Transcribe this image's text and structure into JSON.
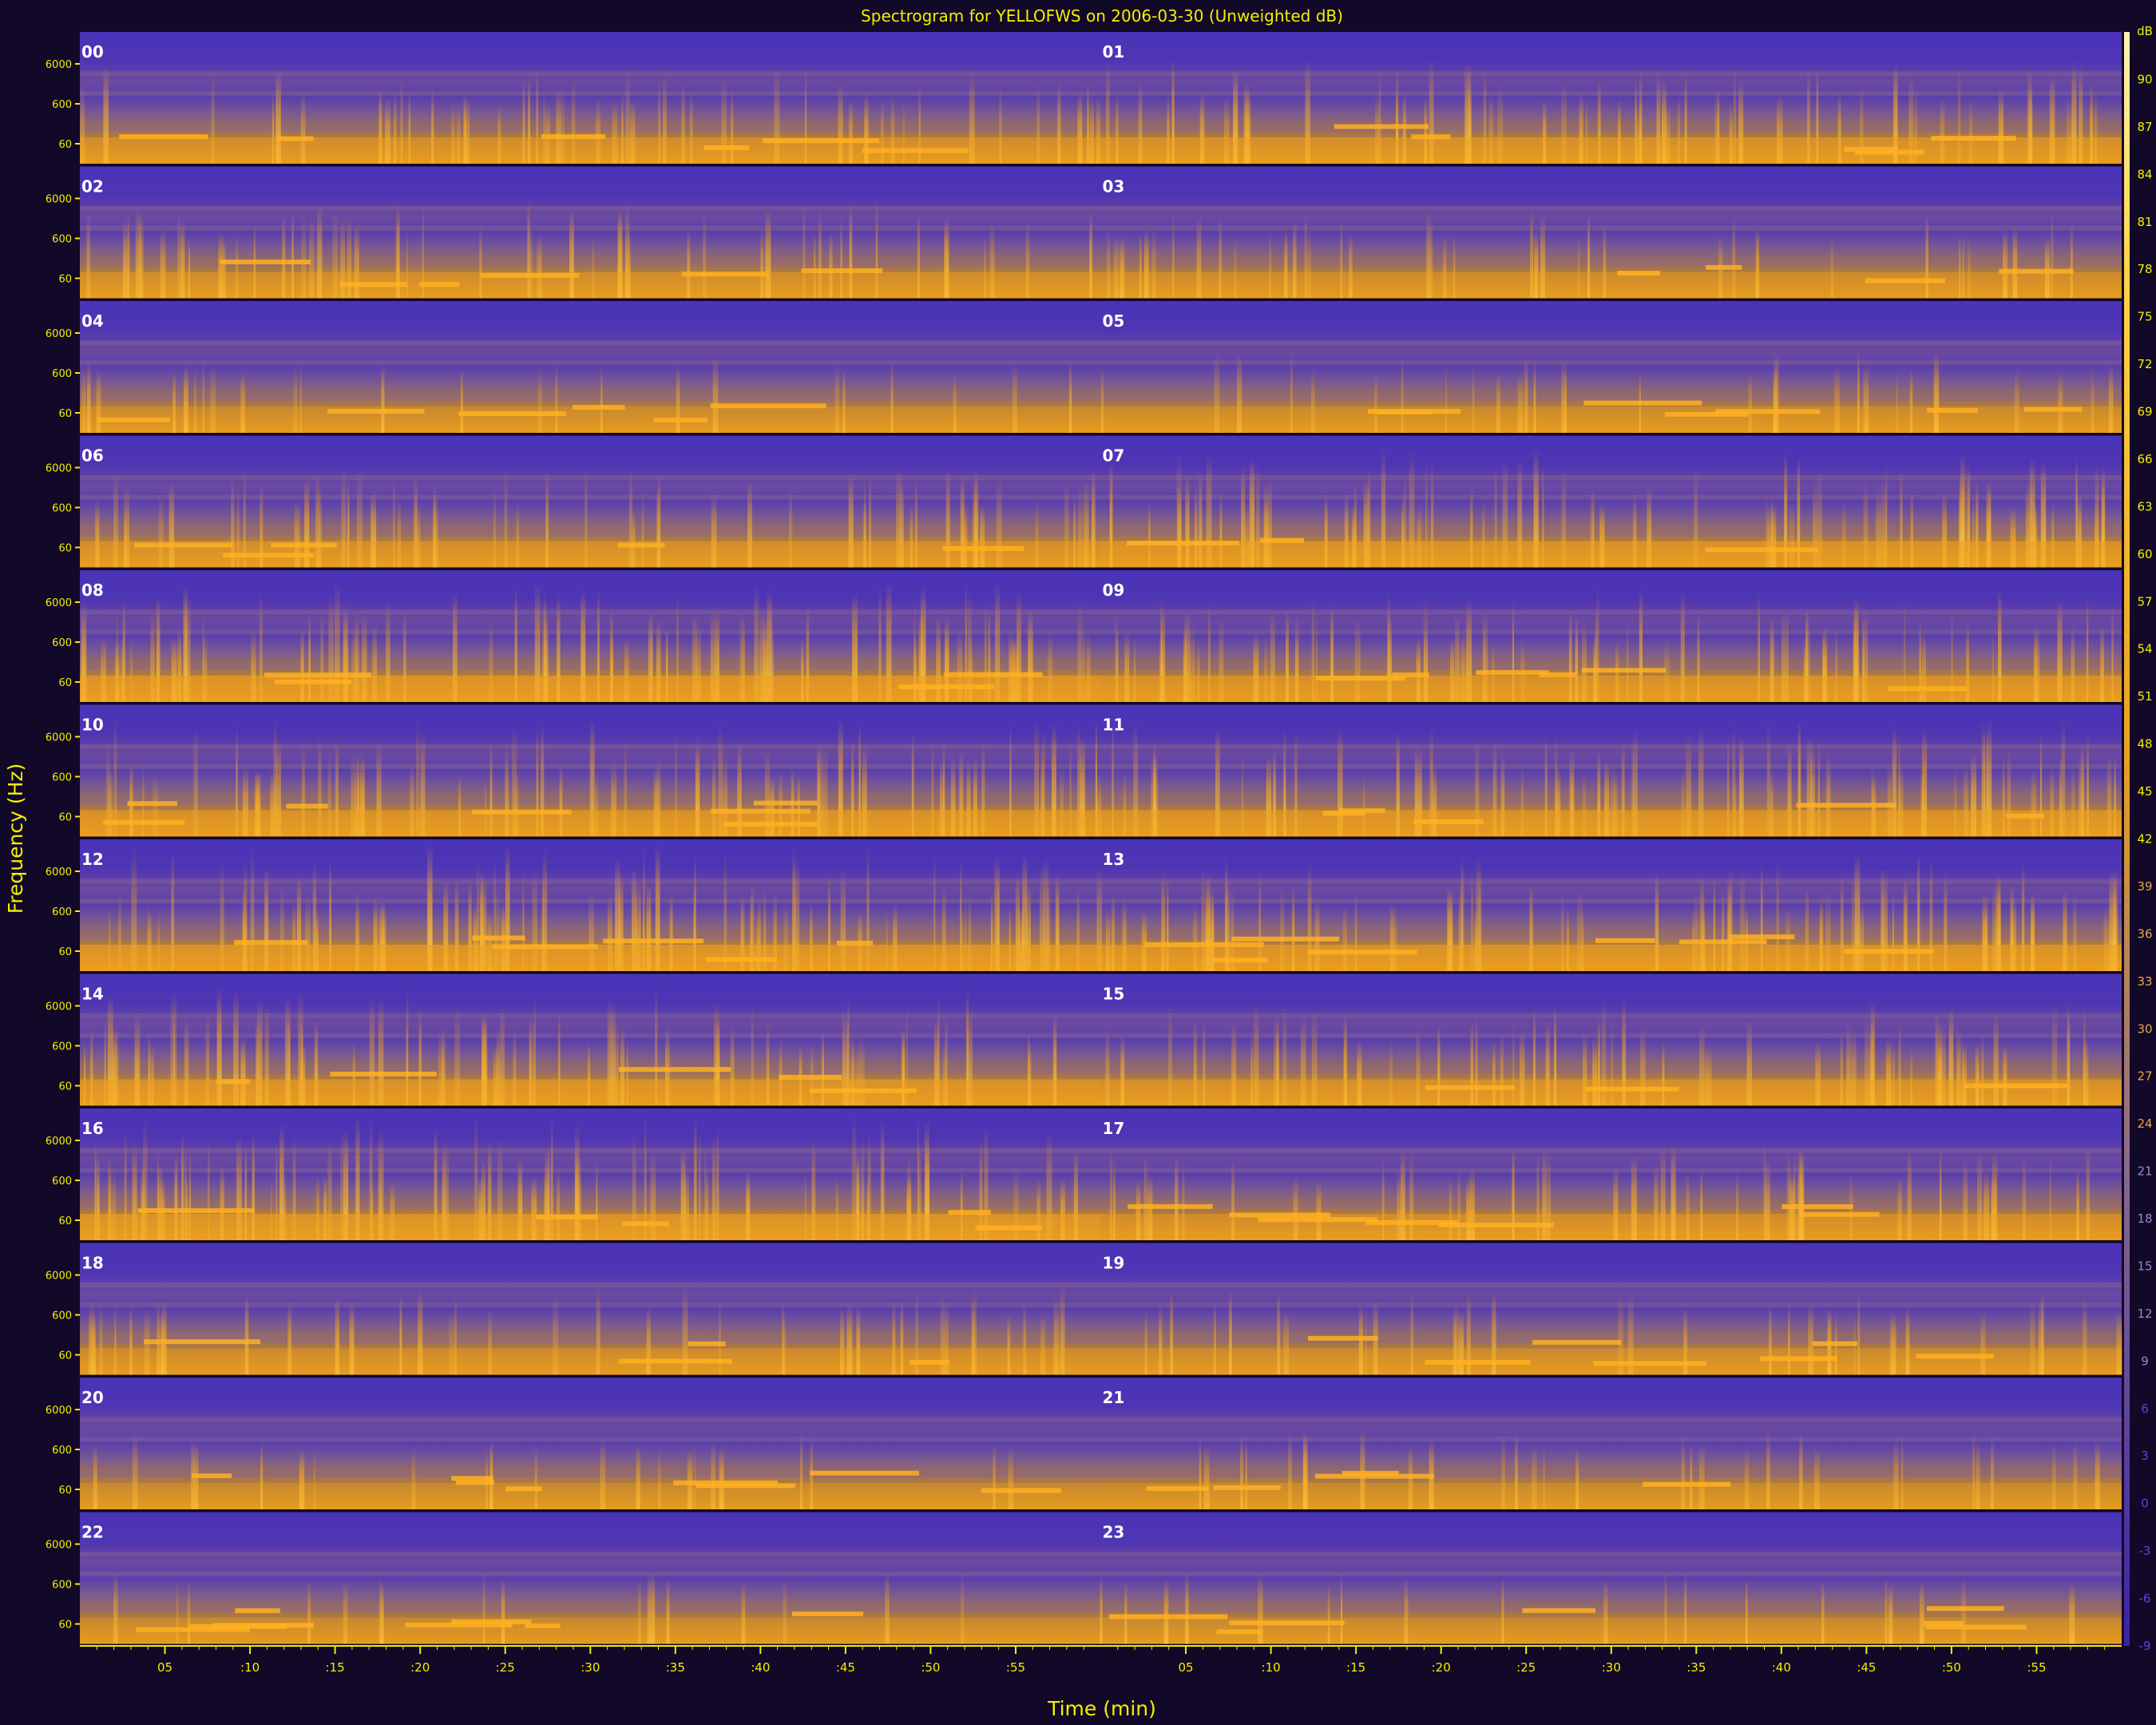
{
  "chart_data": {
    "type": "heatmap",
    "title": "Spectrogram for YELLOFWS on 2006-03-30 (Unweighted dB)",
    "xlabel": "Time (min)",
    "ylabel": "Frequency (Hz)",
    "y_scale": "log",
    "y_ticks": [
      "6000",
      "600",
      "60"
    ],
    "x_ticks": [
      "05",
      ":10",
      ":15",
      ":20",
      ":25",
      ":30",
      ":35",
      ":40",
      ":45",
      ":50",
      ":55"
    ],
    "rows": [
      {
        "hours": [
          "00",
          "01"
        ],
        "activity": [
          0.45,
          0.55
        ]
      },
      {
        "hours": [
          "02",
          "03"
        ],
        "activity": [
          0.45,
          0.35
        ]
      },
      {
        "hours": [
          "04",
          "05"
        ],
        "activity": [
          0.2,
          0.25
        ]
      },
      {
        "hours": [
          "06",
          "07"
        ],
        "activity": [
          0.5,
          0.7
        ]
      },
      {
        "hours": [
          "08",
          "09"
        ],
        "activity": [
          0.75,
          0.65
        ]
      },
      {
        "hours": [
          "10",
          "11"
        ],
        "activity": [
          0.7,
          0.7
        ]
      },
      {
        "hours": [
          "12",
          "13"
        ],
        "activity": [
          0.8,
          0.7
        ]
      },
      {
        "hours": [
          "14",
          "15"
        ],
        "activity": [
          0.7,
          0.55
        ]
      },
      {
        "hours": [
          "16",
          "17"
        ],
        "activity": [
          0.8,
          0.45
        ]
      },
      {
        "hours": [
          "18",
          "19"
        ],
        "activity": [
          0.35,
          0.3
        ]
      },
      {
        "hours": [
          "20",
          "21"
        ],
        "activity": [
          0.2,
          0.25
        ]
      },
      {
        "hours": [
          "22",
          "23"
        ],
        "activity": [
          0.15,
          0.15
        ]
      }
    ],
    "colorbar": {
      "unit": "dB",
      "range": [
        -9,
        93
      ],
      "tick_labels": [
        "90",
        "87",
        "84",
        "81",
        "78",
        "75",
        "72",
        "69",
        "66",
        "63",
        "60",
        "57",
        "54",
        "51",
        "48",
        "45",
        "42",
        "39",
        "36",
        "33",
        "30",
        "27",
        "24",
        "21",
        "18",
        "15",
        "12",
        "9",
        "6",
        "3",
        "0",
        "-3",
        "-6",
        "-9"
      ],
      "colors": {
        "low": "#4a2fb0",
        "mid": "#c9901c",
        "high": "#fff4b0"
      }
    },
    "colors": {
      "background": "#120828",
      "text": "#f2f000",
      "low": "#4a2fb0",
      "high": "#ffb000",
      "hour_label": "#ffffff"
    }
  }
}
